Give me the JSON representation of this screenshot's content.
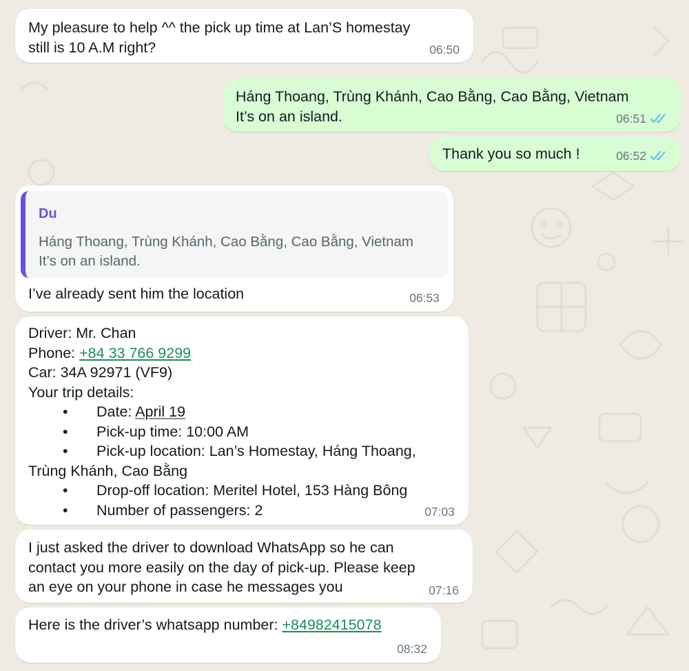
{
  "colors": {
    "wallpaper": "#efeae2",
    "incoming_bubble": "#ffffff",
    "outgoing_bubble": "#d9fdd3",
    "link": "#1b8e5a",
    "quote_accent": "#6b4fe0",
    "read_ticks": "#53bdeb"
  },
  "messages": [
    {
      "direction": "in",
      "lines": [
        "My pleasure to help ^^ the pick up time at Lan’S homestay",
        "still is 10 A.M  right?"
      ],
      "time": "06:50"
    },
    {
      "direction": "out",
      "lines": [
        "Háng Thoang, Trùng Khánh, Cao Bằng, Cao Bằng, Vietnam",
        "It’s on an island."
      ],
      "time": "06:51",
      "status_icon": "double-check-read-icon"
    },
    {
      "direction": "out",
      "lines": [
        "Thank you so much !"
      ],
      "time": "06:52",
      "status_icon": "double-check-read-icon"
    },
    {
      "direction": "in",
      "quote": {
        "author": "Du",
        "lines": [
          "Háng Thoang, Trùng Khánh, Cao Bằng, Cao Bằng, Vietnam",
          "It’s on an island."
        ]
      },
      "lines": [
        "I’ve already sent him the location"
      ],
      "time": "06:53"
    },
    {
      "direction": "in",
      "driver_label": "Driver: Mr. Chan",
      "phone_label": "Phone: ",
      "phone": "+84 33 766 9299",
      "car": "Car: 34A 92971 (VF9)",
      "trip_heading": "Your trip details:",
      "bullet_char": "•",
      "date_label": "Date: ",
      "date_value": "April 19",
      "pickup_time": "Pick-up time: 10:00 AM",
      "pickup_location_1": "Pick-up location: Lan’s Homestay, Háng Thoang,",
      "pickup_location_2": "Trùng Khánh, Cao Bằng",
      "dropoff": "Drop-off location: Meritel Hotel, 153 Hàng Bông",
      "passengers": "Number of passengers: 2",
      "time": "07:03"
    },
    {
      "direction": "in",
      "lines": [
        "I just asked the driver to download WhatsApp so he can",
        "contact you more easily on the day of pick-up. Please keep",
        "an eye on your phone in case he messages you"
      ],
      "time": "07:16"
    },
    {
      "direction": "in",
      "text_label": "Here is the driver’s whatsapp number: ",
      "phone": "+84982415078",
      "time": "08:32"
    }
  ]
}
